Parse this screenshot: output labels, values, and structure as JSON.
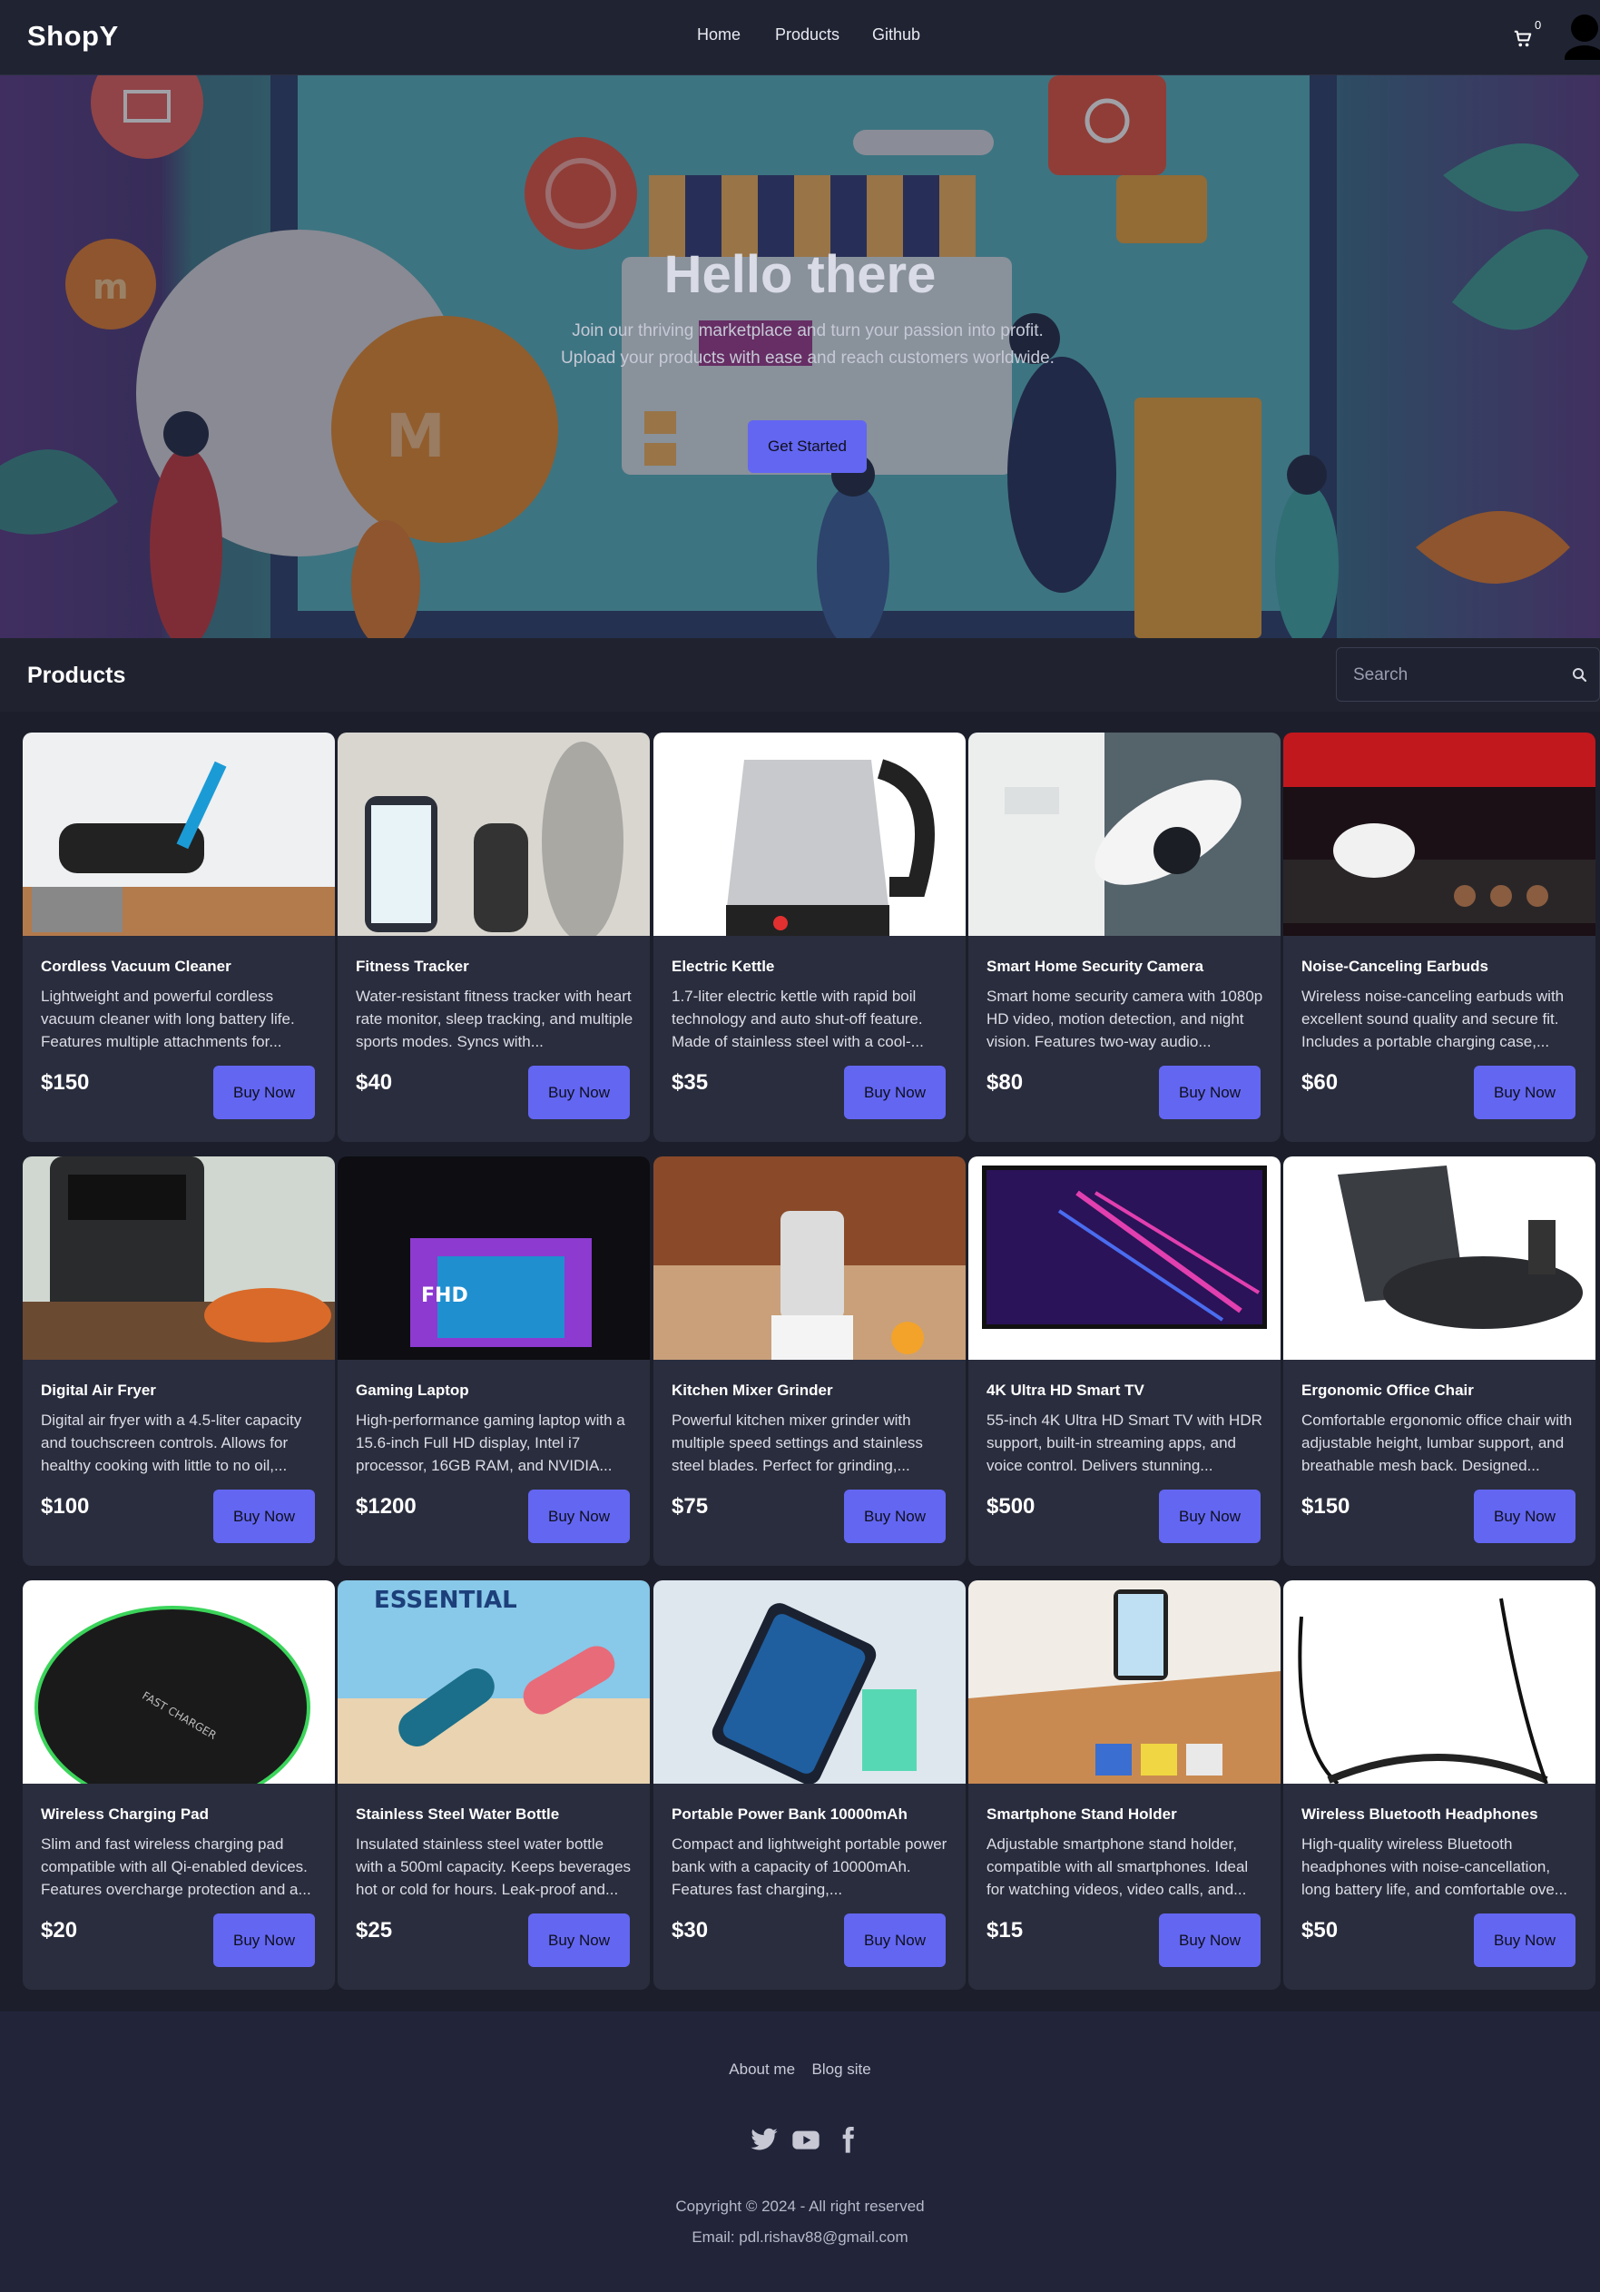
{
  "nav": {
    "brand": "ShopY",
    "links": [
      "Home",
      "Products",
      "Github"
    ],
    "cart_count": "0",
    "cart_icon": "cart-icon",
    "avatar_icon": "user-avatar-icon"
  },
  "hero": {
    "title": "Hello there",
    "subtitle": "Join our thriving marketplace and turn your passion into profit. Upload your products with ease and reach customers worldwide.",
    "button": "Get Started",
    "accent": "#6366f1"
  },
  "products": {
    "heading": "Products",
    "search_placeholder": "Search",
    "search_icon": "search-icon",
    "buy_label": "Buy Now",
    "items": [
      {
        "name": "Cordless Vacuum Cleaner",
        "desc": "Lightweight and powerful cordless vacuum cleaner with long battery life. Features multiple attachments for...",
        "price": "$150",
        "image": "vacuum-cleaner-image"
      },
      {
        "name": "Fitness Tracker",
        "desc": "Water-resistant fitness tracker with heart rate monitor, sleep tracking, and multiple sports modes. Syncs with...",
        "price": "$40",
        "image": "fitness-tracker-image"
      },
      {
        "name": "Electric Kettle",
        "desc": "1.7-liter electric kettle with rapid boil technology and auto shut-off feature. Made of stainless steel with a cool-...",
        "price": "$35",
        "image": "electric-kettle-image"
      },
      {
        "name": "Smart Home Security Camera",
        "desc": "Smart home security camera with 1080p HD video, motion detection, and night vision. Features two-way audio...",
        "price": "$80",
        "image": "security-camera-image"
      },
      {
        "name": "Noise-Canceling Earbuds",
        "desc": "Wireless noise-canceling earbuds with excellent sound quality and secure fit. Includes a portable charging case,...",
        "price": "$60",
        "image": "earbuds-image"
      },
      {
        "name": "Digital Air Fryer",
        "desc": "Digital air fryer with a 4.5-liter capacity and touchscreen controls. Allows for healthy cooking with little to no oil,...",
        "price": "$100",
        "image": "air-fryer-image"
      },
      {
        "name": "Gaming Laptop",
        "desc": "High-performance gaming laptop with a 15.6-inch Full HD display, Intel i7 processor, 16GB RAM, and NVIDIA...",
        "price": "$1200",
        "image": "gaming-laptop-image"
      },
      {
        "name": "Kitchen Mixer Grinder",
        "desc": "Powerful kitchen mixer grinder with multiple speed settings and stainless steel blades. Perfect for grinding,...",
        "price": "$75",
        "image": "mixer-grinder-image"
      },
      {
        "name": "4K Ultra HD Smart TV",
        "desc": "55-inch 4K Ultra HD Smart TV with HDR support, built-in streaming apps, and voice control. Delivers stunning...",
        "price": "$500",
        "image": "smart-tv-image"
      },
      {
        "name": "Ergonomic Office Chair",
        "desc": "Comfortable ergonomic office chair with adjustable height, lumbar support, and breathable mesh back. Designed...",
        "price": "$150",
        "image": "office-chair-image"
      },
      {
        "name": "Wireless Charging Pad",
        "desc": "Slim and fast wireless charging pad compatible with all Qi-enabled devices. Features overcharge protection and a...",
        "price": "$20",
        "image": "charging-pad-image"
      },
      {
        "name": "Stainless Steel Water Bottle",
        "desc": "Insulated stainless steel water bottle with a 500ml capacity. Keeps beverages hot or cold for hours. Leak-proof and...",
        "price": "$25",
        "image": "water-bottle-image"
      },
      {
        "name": "Portable Power Bank 10000mAh",
        "desc": "Compact and lightweight portable power bank with a capacity of 10000mAh. Features fast charging,...",
        "price": "$30",
        "image": "power-bank-image"
      },
      {
        "name": "Smartphone Stand Holder",
        "desc": "Adjustable smartphone stand holder, compatible with all smartphones. Ideal for watching videos, video calls, and...",
        "price": "$15",
        "image": "phone-stand-image"
      },
      {
        "name": "Wireless Bluetooth Headphones",
        "desc": "High-quality wireless Bluetooth headphones with noise-cancellation, long battery life, and comfortable ove...",
        "price": "$50",
        "image": "headphones-image"
      }
    ]
  },
  "footer": {
    "links": [
      "About me",
      "Blog site"
    ],
    "social": [
      "twitter-icon",
      "youtube-icon",
      "facebook-icon"
    ],
    "copyright": "Copyright © 2024 - All right reserved",
    "email": "Email: pdl.rishav88@gmail.com"
  }
}
